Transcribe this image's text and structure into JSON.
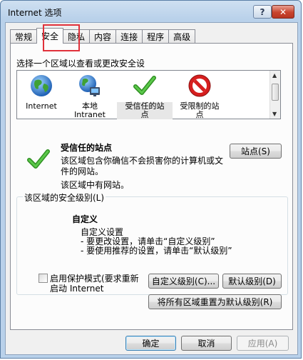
{
  "window": {
    "title": "Internet 选项",
    "help_label": "?",
    "close_label": "✕"
  },
  "tabs": [
    {
      "label": "常规",
      "active": false
    },
    {
      "label": "安全",
      "active": true
    },
    {
      "label": "隐私",
      "active": false
    },
    {
      "label": "内容",
      "active": false
    },
    {
      "label": "连接",
      "active": false
    },
    {
      "label": "程序",
      "active": false
    },
    {
      "label": "高级",
      "active": false
    }
  ],
  "security": {
    "select_zone_label": "选择一个区域以查看或更改安全设",
    "zones": [
      {
        "label": "Internet",
        "icon": "globe-icon"
      },
      {
        "label": "本地\nIntranet",
        "icon": "intranet-globe-icon"
      },
      {
        "label": "受信任的站\n点",
        "icon": "green-check-icon",
        "selected": true
      },
      {
        "label": "受限制的站\n点",
        "icon": "no-entry-icon"
      }
    ],
    "zone_title": "受信任的站点",
    "zone_desc_line1": "该区域包含你确信不会损害你的计算机或文",
    "zone_desc_line2": "件的网站。",
    "zone_has_sites": "该区域中有网站。",
    "sites_button": "站点(S)",
    "level_group_title": "该区域的安全级别(L)",
    "level_name": "自定义",
    "level_desc_1": "自定义设置",
    "level_desc_2": "- 要更改设置，请单击“自定义级别”",
    "level_desc_3": "- 要使用推荐的设置，请单击“默认级别”",
    "protected_mode_line1": "启用保护模式(要求重新",
    "protected_mode_line2": "启动 Internet",
    "protected_mode_checked": false,
    "custom_level_button": "自定义级别(C)...",
    "default_level_button": "默认级别(D)",
    "reset_all_button": "将所有区域重置为默认级别(R)"
  },
  "footer": {
    "ok_button": "确定",
    "cancel_button": "取消",
    "apply_button": "应用(A)"
  },
  "colors": {
    "highlight_red": "#e0313a",
    "check_green": "#3aa12c",
    "window_blue": "#b9d1ea"
  }
}
